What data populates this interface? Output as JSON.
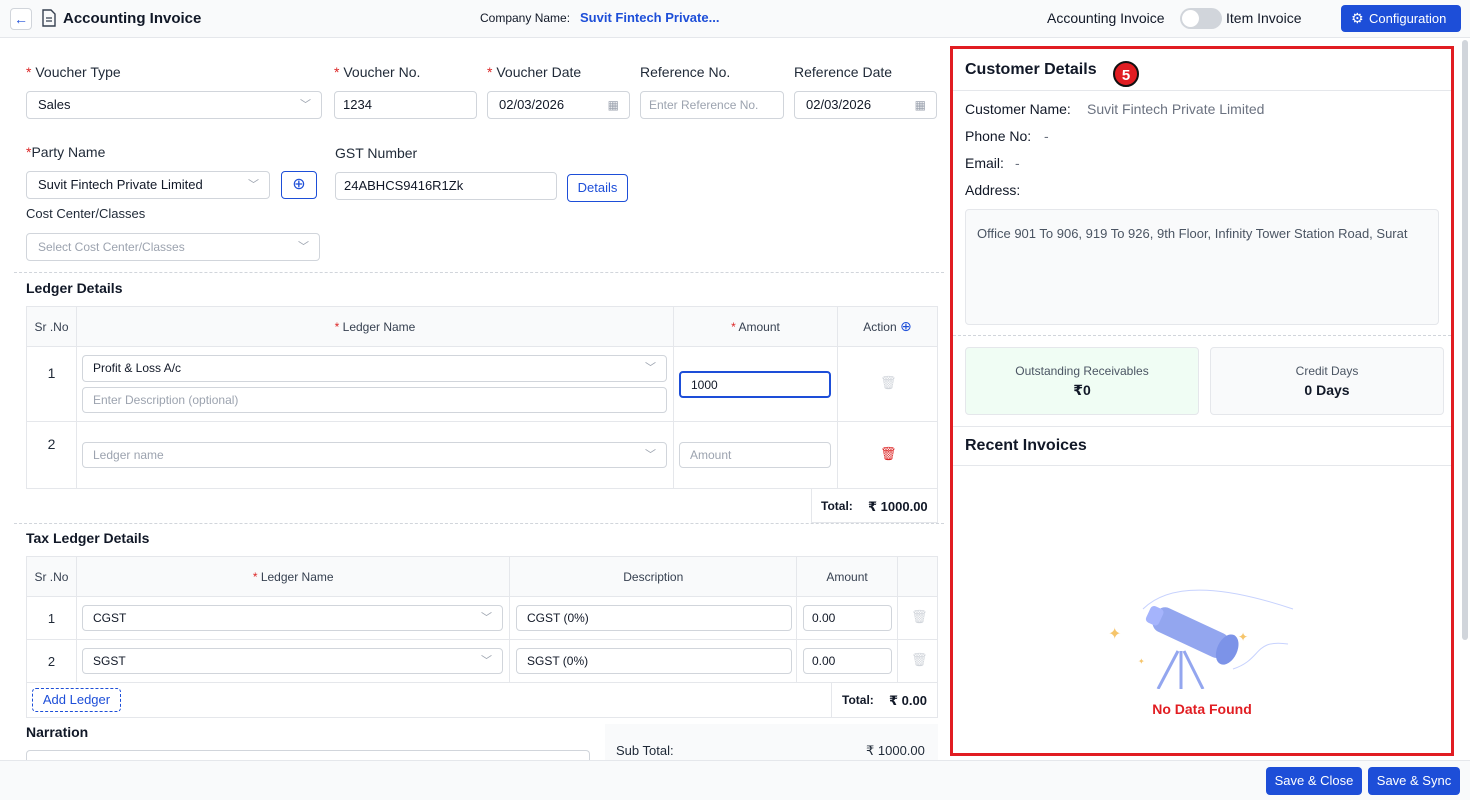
{
  "header": {
    "title": "Accounting Invoice",
    "company_label": "Company Name:",
    "company_value": "Suvit Fintech Private...",
    "toggle_left": "Accounting Invoice",
    "toggle_right": "Item Invoice",
    "config_label": "Configuration"
  },
  "form": {
    "voucher_type_label": "Voucher Type",
    "voucher_type_value": "Sales",
    "voucher_no_label": "Voucher No.",
    "voucher_no_value": "1234",
    "voucher_date_label": "Voucher Date",
    "voucher_date_value": "02/03/2026",
    "reference_no_label": "Reference No.",
    "reference_no_placeholder": "Enter Reference No.",
    "reference_date_label": "Reference Date",
    "reference_date_value": "02/03/2026",
    "party_name_label": "Party Name",
    "party_name_value": "Suvit Fintech Private Limited",
    "gst_label": "GST Number",
    "gst_value": "24ABHCS9416R1Zk",
    "details_label": "Details",
    "cost_center_label": "Cost Center/Classes",
    "cost_center_placeholder": "Select Cost Center/Classes"
  },
  "ledger": {
    "title": "Ledger Details",
    "col_srno": "Sr .No",
    "col_ledger": "Ledger Name",
    "col_amount": "Amount",
    "col_action": "Action",
    "rows": [
      {
        "sr": "1",
        "ledger": "Profit & Loss A/c",
        "desc_placeholder": "Enter Description (optional)",
        "amount": "1000"
      },
      {
        "sr": "2",
        "ledger_placeholder": "Ledger name",
        "amount_placeholder": "Amount"
      }
    ],
    "total_label": "Total:",
    "total_value": "₹ 1000.00"
  },
  "tax": {
    "title": "Tax Ledger Details",
    "col_srno": "Sr .No",
    "col_ledger": "Ledger Name",
    "col_desc": "Description",
    "col_amount": "Amount",
    "rows": [
      {
        "sr": "1",
        "ledger": "CGST",
        "desc": "CGST (0%)",
        "amount": "0.00"
      },
      {
        "sr": "2",
        "ledger": "SGST",
        "desc": "SGST (0%)",
        "amount": "0.00"
      }
    ],
    "add_ledger": "Add Ledger",
    "total_label": "Total:",
    "total_value": "₹ 0.00"
  },
  "narration": {
    "title": "Narration",
    "subtotal_label": "Sub Total:",
    "subtotal_value": "₹ 1000.00"
  },
  "customer": {
    "title": "Customer Details",
    "badge": "5",
    "name_label": "Customer Name:",
    "name_value": "Suvit Fintech Private Limited",
    "phone_label": "Phone No:",
    "phone_value": "-",
    "email_label": "Email:",
    "email_value": "-",
    "address_label": "Address:",
    "address_value": "Office 901 To 906, 919 To 926, 9th Floor, Infinity Tower Station Road, Surat",
    "outstanding_label": "Outstanding Receivables",
    "outstanding_value": "₹0",
    "credit_label": "Credit Days",
    "credit_value": "0 Days",
    "recent_title": "Recent Invoices",
    "no_data": "No Data Found"
  },
  "footer": {
    "save_close": "Save & Close",
    "save_sync": "Save & Sync"
  },
  "colors": {
    "primary": "#1d4ed8",
    "highlight": "#e11d22"
  }
}
